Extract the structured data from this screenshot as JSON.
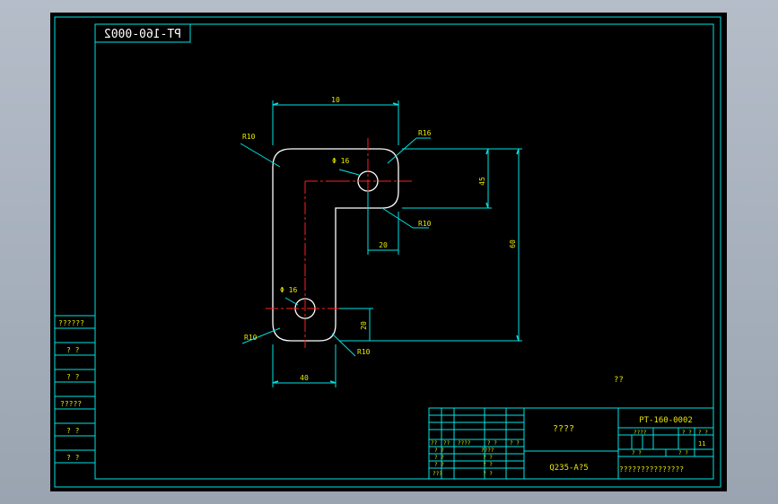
{
  "drawing": {
    "number": "PT-160-0002",
    "mirrored_number": "PT-160-0002",
    "part_name": "????",
    "material": "Q235-A?5",
    "company": "???????????????",
    "note": "??",
    "scale_header": "????",
    "weight_header": "? ?",
    "ratio_header": "? ?",
    "ratio_value": "11",
    "sheet_left": "?  ?",
    "sheet_right": "?  ?"
  },
  "left_strip": {
    "labels": [
      "??????",
      "? ?",
      "? ?",
      "?????",
      "? ?",
      "? ?"
    ]
  },
  "title_grid": {
    "header_row": [
      "??",
      "??",
      "????",
      "? ?",
      "? ?"
    ],
    "row_a": [
      "? ?",
      "????"
    ],
    "row_b": [
      "? ?",
      "? ?"
    ],
    "row_c": [
      "? ?",
      "? ?"
    ],
    "row_d": [
      "???",
      "? ?"
    ]
  },
  "dimensions": {
    "top_width": "10",
    "left_radius": "R10",
    "right_radius": "R16",
    "top_hole": "Φ 16",
    "slot_height": "45",
    "overall_height": "60",
    "inner_radius": "R10",
    "offset_width": "20",
    "bottom_hole": "Φ 16",
    "bottom_left_radius": "R10",
    "bottom_right_radius": "R10",
    "bottom_height": "20",
    "bottom_width": "40"
  },
  "colors": {
    "frame": "#00e5e5",
    "part": "#ffffff",
    "centerline": "#ff2020",
    "dimension_text": "#e8e800",
    "title_text": "#00ff00"
  }
}
